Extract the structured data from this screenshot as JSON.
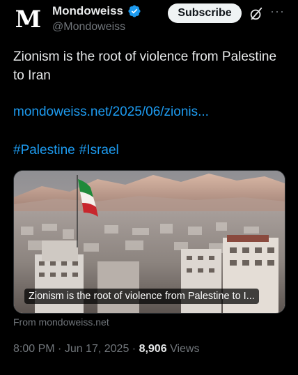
{
  "author": {
    "avatar_letter": "M",
    "name": "Mondoweiss",
    "handle": "@Mondoweiss",
    "verified_icon": "verified-badge-icon",
    "verified_color": "#1d9bf0"
  },
  "actions": {
    "subscribe_label": "Subscribe",
    "grok_icon": "grok-icon",
    "more_label": "···"
  },
  "post": {
    "text": "Zionism is the root of violence from Palestine to Iran",
    "link": "mondoweiss.net/2025/06/zionis...",
    "hashtags": [
      "#Palestine",
      "#Israel"
    ]
  },
  "card": {
    "image_description": "tehran-skyline-with-iranian-flag",
    "caption": "Zionism is the root of violence from Palestine to I...",
    "source": "From mondoweiss.net"
  },
  "meta": {
    "time": "8:00 PM",
    "separator": " · ",
    "date": "Jun 17, 2025",
    "views_count": "8,906",
    "views_label": "Views"
  },
  "colors": {
    "background": "#000000",
    "text": "#e7e9ea",
    "secondary": "#71767b",
    "accent": "#1d9bf0"
  }
}
